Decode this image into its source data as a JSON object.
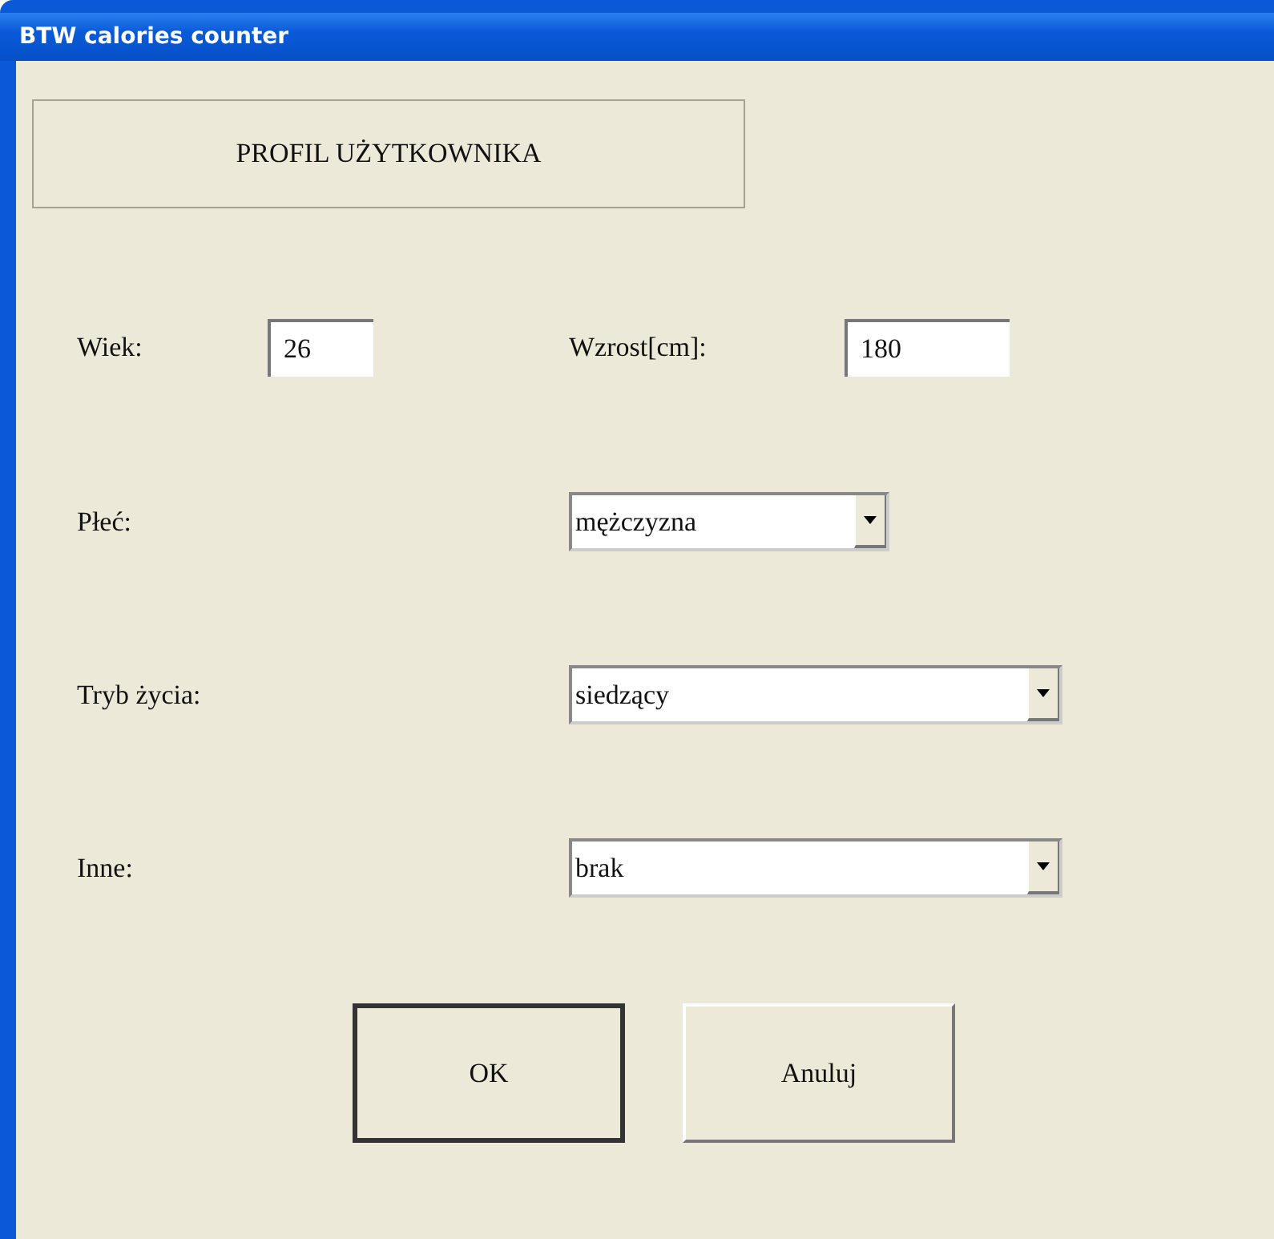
{
  "window": {
    "title": "BTW calories counter"
  },
  "header": "PROFIL UŻYTKOWNIKA",
  "row_1": [
    {
      "label": "Wiek:",
      "value": "26"
    },
    {
      "label": "Wzrost[cm]:",
      "value": "180"
    }
  ],
  "fields": [
    {
      "label": "Płeć:",
      "value": "mężczyzna",
      "kind": "short"
    },
    {
      "label": "Tryb życia:",
      "value": "siedzący",
      "kind": "long"
    },
    {
      "label": "Inne:",
      "value": "brak",
      "kind": "long"
    }
  ],
  "buttons": [
    {
      "label": "OK",
      "default": true
    },
    {
      "label": "Anuluj",
      "default": false
    }
  ]
}
